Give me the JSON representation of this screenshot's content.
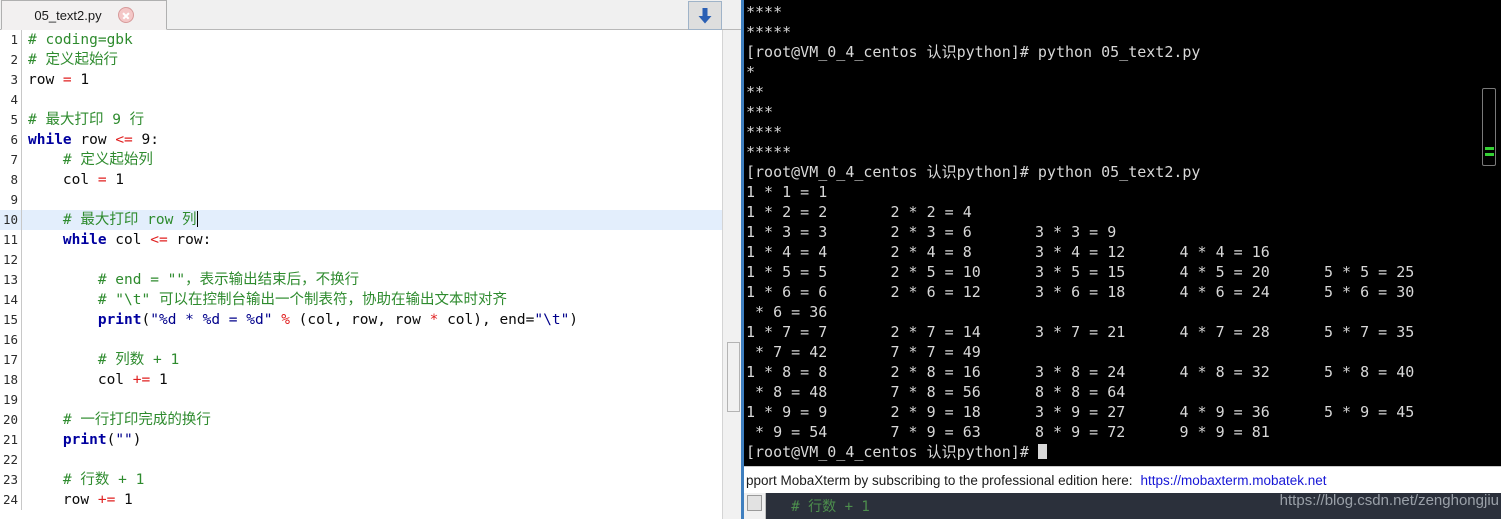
{
  "editor": {
    "tab": {
      "title": "05_text2.py",
      "close_icon": "close-icon"
    },
    "download_button": {
      "icon": "download-arrow-icon"
    },
    "lines": [
      {
        "num": "1",
        "current": false,
        "segments": [
          {
            "cls": "tok-comment",
            "text": "# coding=gbk"
          }
        ]
      },
      {
        "num": "2",
        "current": false,
        "segments": [
          {
            "cls": "tok-comment",
            "text": "# 定义起始行"
          }
        ]
      },
      {
        "num": "3",
        "current": false,
        "segments": [
          {
            "cls": "tok-plain",
            "text": "row "
          },
          {
            "cls": "tok-op",
            "text": "="
          },
          {
            "cls": "tok-plain",
            "text": " 1"
          }
        ]
      },
      {
        "num": "4",
        "current": false,
        "segments": [
          {
            "cls": "tok-plain",
            "text": ""
          }
        ]
      },
      {
        "num": "5",
        "current": false,
        "segments": [
          {
            "cls": "tok-comment",
            "text": "# 最大打印 9 行"
          }
        ]
      },
      {
        "num": "6",
        "current": false,
        "segments": [
          {
            "cls": "tok-kw",
            "text": "while"
          },
          {
            "cls": "tok-plain",
            "text": " row "
          },
          {
            "cls": "tok-op",
            "text": "<="
          },
          {
            "cls": "tok-plain",
            "text": " 9:"
          }
        ]
      },
      {
        "num": "7",
        "current": false,
        "segments": [
          {
            "cls": "tok-comment",
            "text": "    # 定义起始列"
          }
        ]
      },
      {
        "num": "8",
        "current": false,
        "segments": [
          {
            "cls": "tok-plain",
            "text": "    col "
          },
          {
            "cls": "tok-op",
            "text": "="
          },
          {
            "cls": "tok-plain",
            "text": " 1"
          }
        ]
      },
      {
        "num": "9",
        "current": false,
        "segments": [
          {
            "cls": "tok-plain",
            "text": ""
          }
        ]
      },
      {
        "num": "10",
        "current": true,
        "caret": true,
        "segments": [
          {
            "cls": "tok-comment",
            "text": "    # 最大打印 row 列"
          }
        ]
      },
      {
        "num": "11",
        "current": false,
        "segments": [
          {
            "cls": "tok-plain",
            "text": "    "
          },
          {
            "cls": "tok-kw",
            "text": "while"
          },
          {
            "cls": "tok-plain",
            "text": " col "
          },
          {
            "cls": "tok-op",
            "text": "<="
          },
          {
            "cls": "tok-plain",
            "text": " row:"
          }
        ]
      },
      {
        "num": "12",
        "current": false,
        "segments": [
          {
            "cls": "tok-plain",
            "text": ""
          }
        ]
      },
      {
        "num": "13",
        "current": false,
        "segments": [
          {
            "cls": "tok-comment",
            "text": "        # end = \"\"，表示输出结束后，不换行"
          }
        ]
      },
      {
        "num": "14",
        "current": false,
        "segments": [
          {
            "cls": "tok-comment",
            "text": "        # \"\\t\" 可以在控制台输出一个制表符，协助在输出文本时对齐"
          }
        ]
      },
      {
        "num": "15",
        "current": false,
        "segments": [
          {
            "cls": "tok-plain",
            "text": "        "
          },
          {
            "cls": "tok-fn",
            "text": "print"
          },
          {
            "cls": "tok-plain",
            "text": "("
          },
          {
            "cls": "tok-str",
            "text": "\"%d * %d = %d\""
          },
          {
            "cls": "tok-plain",
            "text": " "
          },
          {
            "cls": "tok-op",
            "text": "%"
          },
          {
            "cls": "tok-plain",
            "text": " (col, row, row "
          },
          {
            "cls": "tok-op",
            "text": "*"
          },
          {
            "cls": "tok-plain",
            "text": " col), end="
          },
          {
            "cls": "tok-str",
            "text": "\"\\t\""
          },
          {
            "cls": "tok-plain",
            "text": ")"
          }
        ]
      },
      {
        "num": "16",
        "current": false,
        "segments": [
          {
            "cls": "tok-plain",
            "text": ""
          }
        ]
      },
      {
        "num": "17",
        "current": false,
        "segments": [
          {
            "cls": "tok-comment",
            "text": "        # 列数 + 1"
          }
        ]
      },
      {
        "num": "18",
        "current": false,
        "segments": [
          {
            "cls": "tok-plain",
            "text": "        col "
          },
          {
            "cls": "tok-op",
            "text": "+="
          },
          {
            "cls": "tok-plain",
            "text": " 1"
          }
        ]
      },
      {
        "num": "19",
        "current": false,
        "segments": [
          {
            "cls": "tok-plain",
            "text": ""
          }
        ]
      },
      {
        "num": "20",
        "current": false,
        "segments": [
          {
            "cls": "tok-comment",
            "text": "    # 一行打印完成的换行"
          }
        ]
      },
      {
        "num": "21",
        "current": false,
        "segments": [
          {
            "cls": "tok-plain",
            "text": "    "
          },
          {
            "cls": "tok-fn",
            "text": "print"
          },
          {
            "cls": "tok-plain",
            "text": "("
          },
          {
            "cls": "tok-str",
            "text": "\"\""
          },
          {
            "cls": "tok-plain",
            "text": ")"
          }
        ]
      },
      {
        "num": "22",
        "current": false,
        "segments": [
          {
            "cls": "tok-plain",
            "text": ""
          }
        ]
      },
      {
        "num": "23",
        "current": false,
        "segments": [
          {
            "cls": "tok-comment",
            "text": "    # 行数 + 1"
          }
        ]
      },
      {
        "num": "24",
        "current": false,
        "segments": [
          {
            "cls": "tok-plain",
            "text": "    row "
          },
          {
            "cls": "tok-op",
            "text": "+="
          },
          {
            "cls": "tok-plain",
            "text": " 1"
          }
        ]
      }
    ]
  },
  "terminal": {
    "lines": [
      "****",
      "*****",
      "[root@VM_0_4_centos 认识python]# python 05_text2.py",
      "*",
      "**",
      "***",
      "****",
      "*****",
      "[root@VM_0_4_centos 认识python]# python 05_text2.py",
      "1 * 1 = 1",
      "1 * 2 = 2       2 * 2 = 4",
      "1 * 3 = 3       2 * 3 = 6       3 * 3 = 9",
      "1 * 4 = 4       2 * 4 = 8       3 * 4 = 12      4 * 4 = 16",
      "1 * 5 = 5       2 * 5 = 10      3 * 5 = 15      4 * 5 = 20      5 * 5 = 25",
      "1 * 6 = 6       2 * 6 = 12      3 * 6 = 18      4 * 6 = 24      5 * 6 = 30",
      " * 6 = 36",
      "1 * 7 = 7       2 * 7 = 14      3 * 7 = 21      4 * 7 = 28      5 * 7 = 35",
      " * 7 = 42       7 * 7 = 49",
      "1 * 8 = 8       2 * 8 = 16      3 * 8 = 24      4 * 8 = 32      5 * 8 = 40",
      " * 8 = 48       7 * 8 = 56      8 * 8 = 64",
      "1 * 9 = 9       2 * 9 = 18      3 * 9 = 27      4 * 9 = 36      5 * 9 = 45",
      " * 9 = 54       7 * 9 = 63      8 * 9 = 72      9 * 9 = 81"
    ],
    "prompt": "[root@VM_0_4_centos 认识python]# ",
    "scrollbar_marks": 2
  },
  "status_bar": {
    "text": "pport MobaXterm by subscribing to the professional edition here:",
    "link": "https://mobaxterm.mobatek.net"
  },
  "bottom_window": {
    "text": "   # 行数 + 1"
  },
  "watermark": {
    "text": "https://blog.csdn.net/zenghongjiu"
  },
  "colors": {
    "comment_green": "#2e8b2e",
    "keyword_blue": "#00009f",
    "operator_red": "#e02020",
    "string_blue": "#00008b",
    "current_line": "#e3eefc",
    "terminal_bg": "#000000",
    "terminal_fg": "#d8d8d8",
    "link_blue": "#1616d6",
    "scroll_mark_green": "#35d135"
  }
}
